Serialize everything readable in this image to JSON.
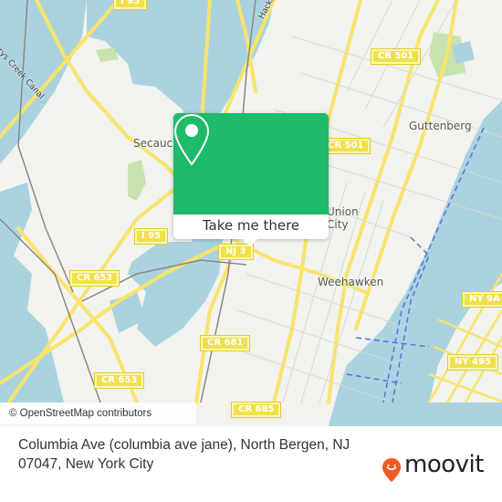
{
  "map": {
    "road_labels": [
      {
        "text": "I 95",
        "id": "i95-top"
      },
      {
        "text": "CR 501",
        "id": "cr501-top"
      },
      {
        "text": "CR 501",
        "id": "cr501-mid"
      },
      {
        "text": "I 95",
        "id": "i95-mid"
      },
      {
        "text": "NJ 3",
        "id": "nj3"
      },
      {
        "text": "CR 653",
        "id": "cr653-upper"
      },
      {
        "text": "CR 653",
        "id": "cr653-lower"
      },
      {
        "text": "CR 681",
        "id": "cr681"
      },
      {
        "text": "CR 685",
        "id": "cr685"
      },
      {
        "text": "NY 9A",
        "id": "ny9a"
      },
      {
        "text": "NY 495",
        "id": "ny495"
      }
    ],
    "place_labels": [
      {
        "text": "Secaucus",
        "id": "secaucus"
      },
      {
        "text": "Guttenberg",
        "id": "guttenberg"
      },
      {
        "text": "Union City",
        "id": "union-city"
      },
      {
        "text": "Weehawken",
        "id": "weehawken"
      }
    ],
    "water_labels": [
      {
        "text": "Berrys Creek Canal",
        "id": "berrys-creek"
      },
      {
        "text": "Hackensack",
        "id": "hackensack"
      }
    ],
    "attribution": "© OpenStreetMap contributors"
  },
  "popup": {
    "button_label": "Take me there",
    "icon": "location-pin-icon",
    "color": "#1fba6a"
  },
  "footer": {
    "address_line": "Columbia Ave (columbia ave jane), North Bergen, NJ 07047, New York City",
    "logo_text": "moovit",
    "logo_color": "#f05a28"
  },
  "colors": {
    "water": "#aad3df",
    "land": "#f2f2ee",
    "road": "#f7e46a",
    "park": "#c8e2b0"
  }
}
